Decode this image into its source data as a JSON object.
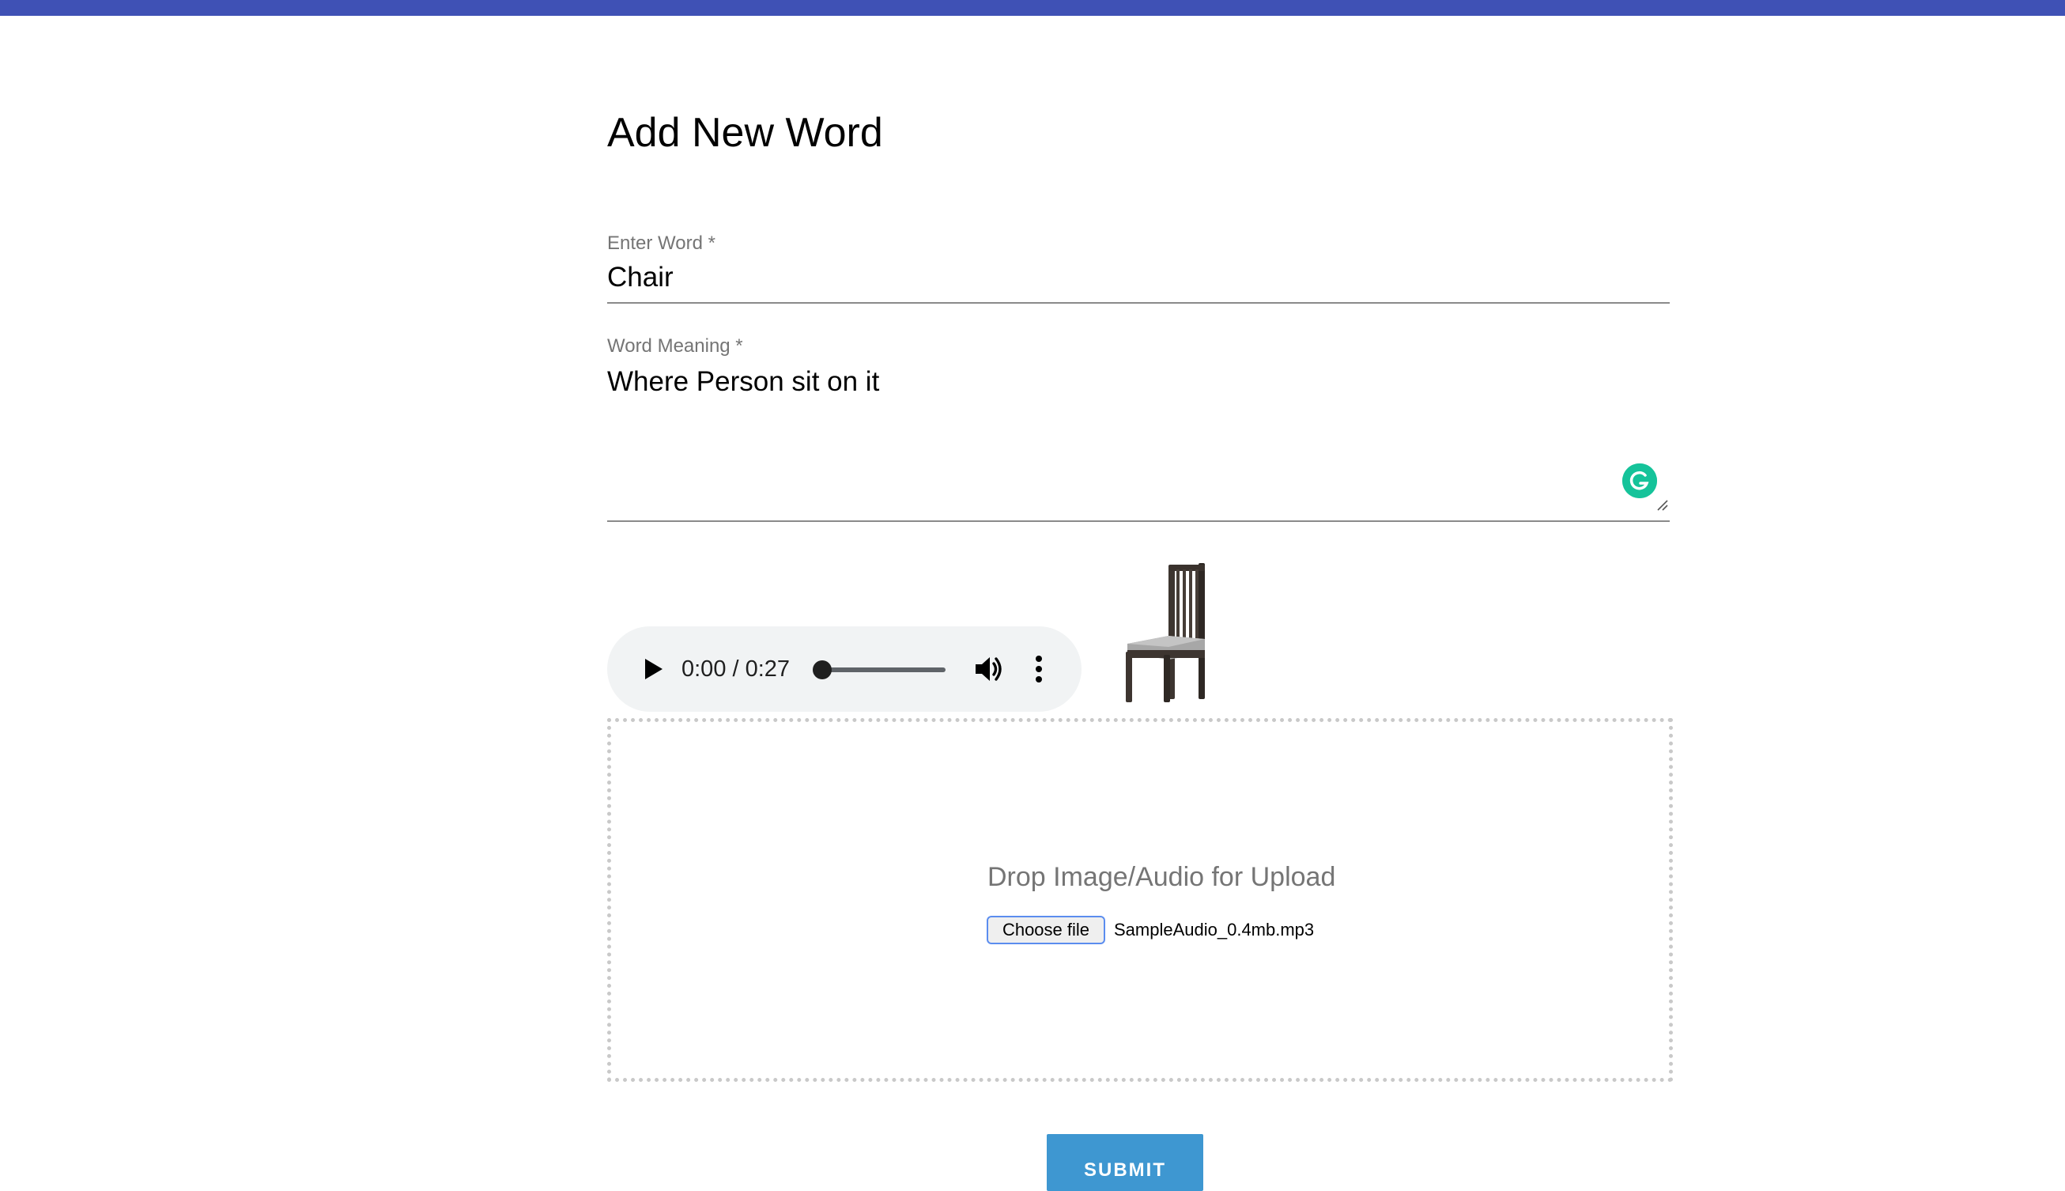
{
  "header": {
    "bar_color": "#3f51b5"
  },
  "page": {
    "title": "Add New Word"
  },
  "form": {
    "word_field": {
      "label": "Enter Word *",
      "value": "Chair"
    },
    "meaning_field": {
      "label": "Word Meaning *",
      "value": "Where Person sit on it",
      "extension_icon": "grammarly-icon"
    },
    "audio_player": {
      "time_display": "0:00 / 0:27",
      "progress": 0,
      "icons": [
        "play-icon",
        "volume-icon",
        "more-vertical-icon"
      ]
    },
    "preview_image": {
      "icon": "chair-image"
    },
    "dropzone": {
      "prompt": "Drop Image/Audio for Upload",
      "choose_file_label": "Choose file",
      "selected_file": "SampleAudio_0.4mb.mp3"
    },
    "submit_label": "SUBMIT"
  },
  "colors": {
    "accent": "#3f51b5",
    "submit": "#3e97d1",
    "grammarly": "#15c39a",
    "dropzone_border": "#c9c9c9"
  }
}
